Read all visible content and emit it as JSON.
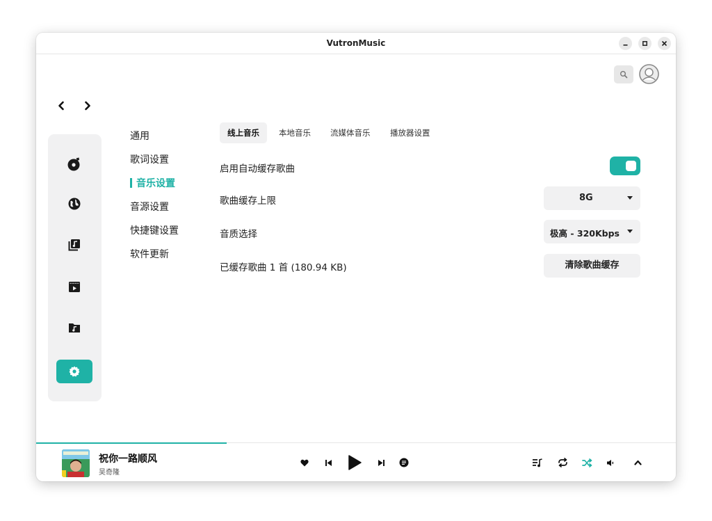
{
  "window": {
    "title": "VutronMusic"
  },
  "settings_nav": {
    "items": [
      {
        "label": "通用",
        "active": false
      },
      {
        "label": "歌词设置",
        "active": false
      },
      {
        "label": "音乐设置",
        "active": true
      },
      {
        "label": "音源设置",
        "active": false
      },
      {
        "label": "快捷键设置",
        "active": false
      },
      {
        "label": "软件更新",
        "active": false
      }
    ]
  },
  "tabs": [
    {
      "label": "线上音乐",
      "active": true
    },
    {
      "label": "本地音乐",
      "active": false
    },
    {
      "label": "流媒体音乐",
      "active": false
    },
    {
      "label": "播放器设置",
      "active": false
    }
  ],
  "settings": {
    "auto_cache": {
      "label": "启用自动缓存歌曲",
      "enabled": true
    },
    "cache_limit": {
      "label": "歌曲缓存上限",
      "value": "8G"
    },
    "quality": {
      "label": "音质选择",
      "value": "极高 - 320Kbps"
    },
    "cached": {
      "label": "已缓存歌曲 1 首 (180.94 KB)",
      "button": "清除歌曲缓存"
    }
  },
  "player": {
    "song_title": "祝你一路顺风",
    "artist": "吴奇隆",
    "progress": 0.3
  },
  "colors": {
    "accent": "#1fb2a6",
    "surface": "#f1f1f2"
  },
  "icons": {
    "sidebar": [
      "music-disc-icon",
      "globe-icon",
      "music-library-icon",
      "video-icon",
      "music-folder-icon",
      "gear-icon"
    ],
    "player_controls": [
      "heart-icon",
      "previous-icon",
      "play-icon",
      "next-icon",
      "lyrics-icon"
    ],
    "player_right": [
      "playlist-icon",
      "repeat-icon",
      "shuffle-icon",
      "volume-icon",
      "chevron-up-icon"
    ]
  }
}
